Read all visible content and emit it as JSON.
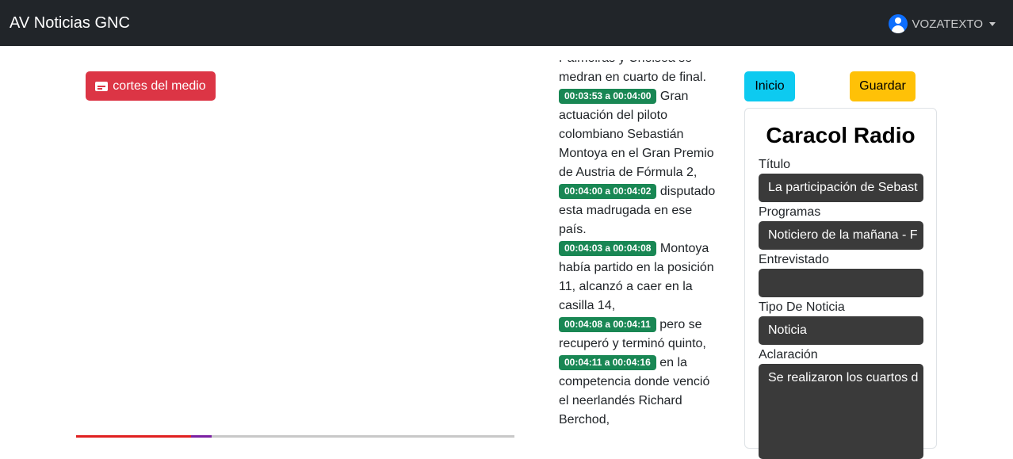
{
  "navbar": {
    "brand": "AV Noticias GNC",
    "user": "VOZATEXTO"
  },
  "left": {
    "cortes_button": "cortes del medio"
  },
  "transcript": {
    "lead_text_1": "Palmeiras y Chelsea se",
    "lead_text_2": "medran en cuarto de final.",
    "segments": [
      {
        "time": "00:03:53 a 00:04:00",
        "text": "Gran actuación del piloto colombiano Sebastián Montoya en el Gran Premio de Austria de Fórmula 2,"
      },
      {
        "time": "00:04:00 a 00:04:02",
        "text": "disputado esta madrugada en ese país."
      },
      {
        "time": "00:04:03 a 00:04:08",
        "text": "Montoya había partido en la posición 11, alcanzó a caer en la casilla 14,"
      },
      {
        "time": "00:04:08 a 00:04:11",
        "text": "pero se recuperó y terminó quinto,"
      },
      {
        "time": "00:04:11 a 00:04:16",
        "text": "en la competencia donde venció el neerlandés Richard Berchod,"
      }
    ]
  },
  "actions": {
    "inicio": "Inicio",
    "guardar": "Guardar"
  },
  "form": {
    "station": "Caracol Radio",
    "titulo_label": "Título",
    "titulo_value": "La participación de Sebast",
    "programas_label": "Programas",
    "programas_value": "Noticiero de la mañana - F",
    "entrevistado_label": "Entrevistado",
    "entrevistado_value": "",
    "tipo_label": "Tipo De Noticia",
    "tipo_value": "Noticia",
    "aclaracion_label": "Aclaración",
    "aclaracion_value": "Se realizaron los cuartos d"
  },
  "colors": {
    "navbar": "#212529",
    "danger": "#dc3545",
    "info": "#0dcaf0",
    "warning": "#ffc107",
    "success_badge": "#198754",
    "input_bg": "#3a3a3a"
  }
}
